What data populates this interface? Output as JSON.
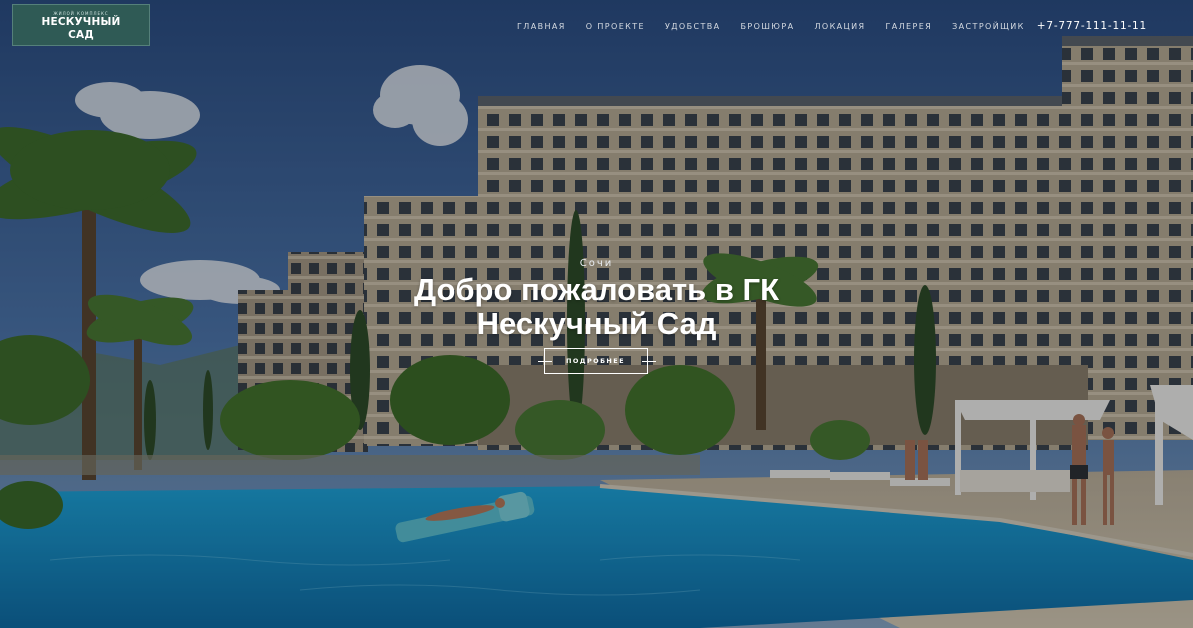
{
  "logo": {
    "small_text": "ЖИЛОЙ КОМПЛЕКС",
    "line1": "НЕСКУЧНЫЙ",
    "line2": "САД"
  },
  "nav": {
    "items": [
      {
        "label": "ГЛАВНАЯ"
      },
      {
        "label": "О ПРОЕКТЕ"
      },
      {
        "label": "УДОБСТВА"
      },
      {
        "label": "БРОШЮРА"
      },
      {
        "label": "ЛОКАЦИЯ"
      },
      {
        "label": "ГАЛЕРЕЯ"
      },
      {
        "label": "ЗАСТРОЙЩИК"
      }
    ],
    "phone": "+7-777-111-11-11"
  },
  "hero": {
    "city": "Сочи",
    "title": "Добро пожаловать в ГК Нескучный Сад",
    "cta_label": "ПОДРОБНЕЕ"
  },
  "colors": {
    "logo_bg": "#2f5a55",
    "sky": "#3a5a86",
    "pool": "#1e9ad6"
  }
}
